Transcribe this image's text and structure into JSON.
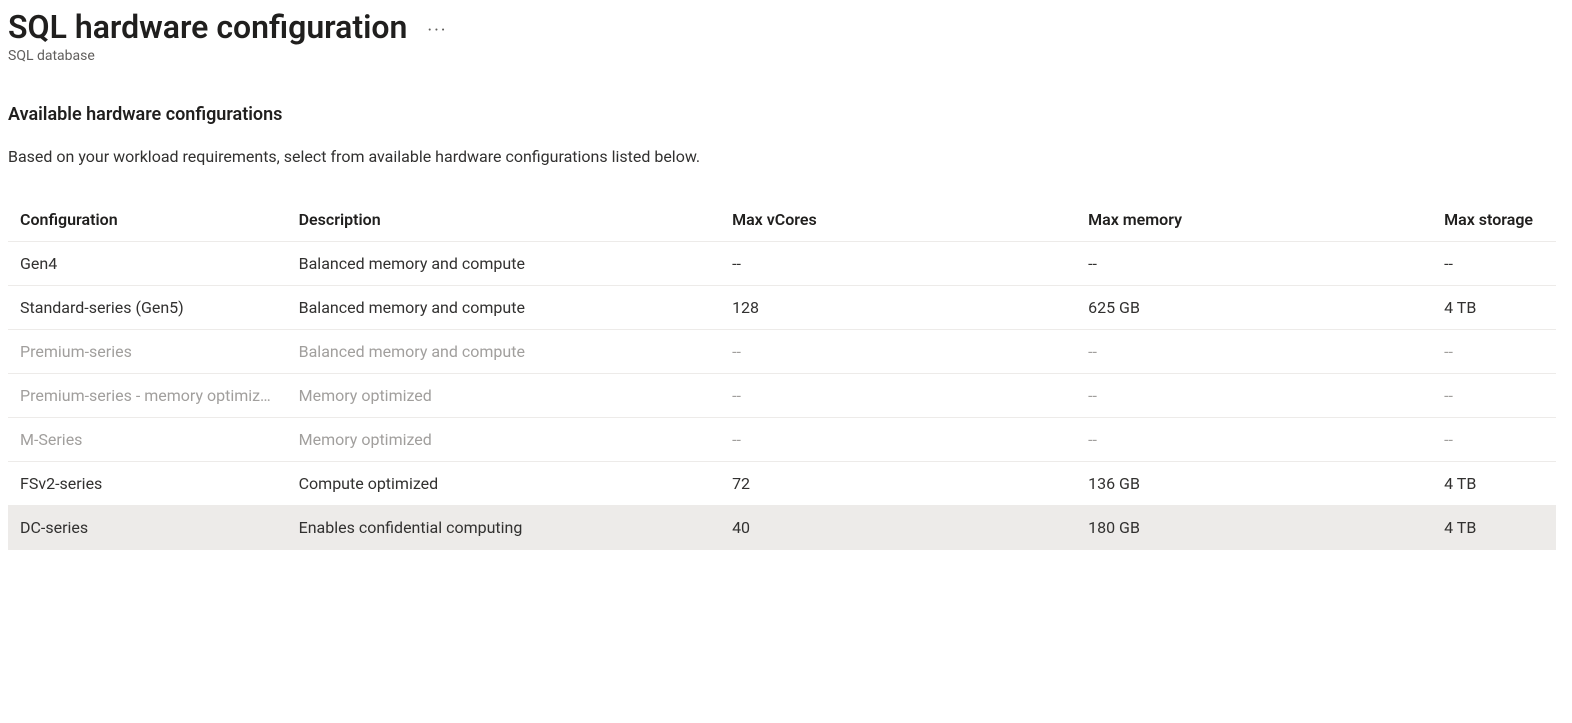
{
  "header": {
    "title": "SQL hardware configuration",
    "subtitle": "SQL database"
  },
  "section": {
    "title": "Available hardware configurations",
    "description": "Based on your workload requirements, select from available hardware configurations listed below."
  },
  "table": {
    "headers": {
      "config": "Configuration",
      "desc": "Description",
      "vcores": "Max vCores",
      "memory": "Max memory",
      "storage": "Max storage"
    },
    "rows": [
      {
        "config": "Gen4",
        "desc": "Balanced memory and compute",
        "vcores": "--",
        "memory": "--",
        "storage": "--",
        "disabled": false,
        "selected": false
      },
      {
        "config": "Standard-series (Gen5)",
        "desc": "Balanced memory and compute",
        "vcores": "128",
        "memory": "625 GB",
        "storage": "4 TB",
        "disabled": false,
        "selected": false
      },
      {
        "config": "Premium-series",
        "desc": "Balanced memory and compute",
        "vcores": "--",
        "memory": "--",
        "storage": "--",
        "disabled": true,
        "selected": false
      },
      {
        "config": "Premium-series - memory optimized",
        "desc": "Memory optimized",
        "vcores": "--",
        "memory": "--",
        "storage": "--",
        "disabled": true,
        "selected": false
      },
      {
        "config": "M-Series",
        "desc": "Memory optimized",
        "vcores": "--",
        "memory": "--",
        "storage": "--",
        "disabled": true,
        "selected": false
      },
      {
        "config": "FSv2-series",
        "desc": "Compute optimized",
        "vcores": "72",
        "memory": "136 GB",
        "storage": "4 TB",
        "disabled": false,
        "selected": false
      },
      {
        "config": "DC-series",
        "desc": "Enables confidential computing",
        "vcores": "40",
        "memory": "180 GB",
        "storage": "4 TB",
        "disabled": false,
        "selected": true
      }
    ]
  }
}
